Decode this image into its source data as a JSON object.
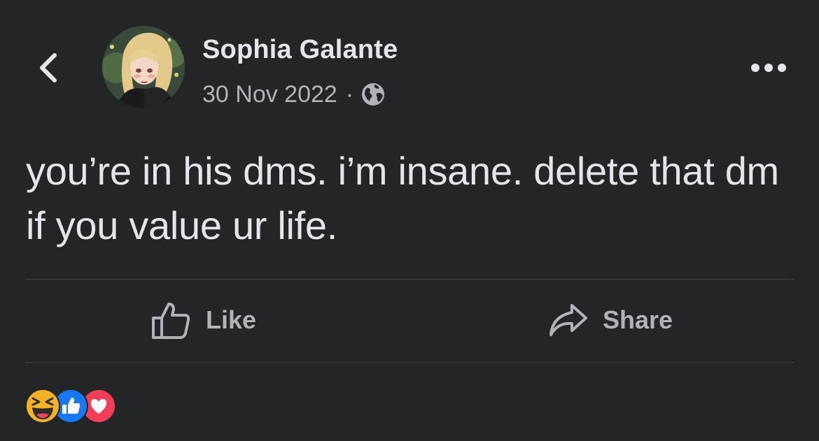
{
  "post": {
    "author": "Sophia Galante",
    "date": "30 Nov 2022",
    "separator": "·",
    "visibility_icon": "globe-icon",
    "text": "you’re in his dms. i’m insane. delete that dm if you value ur life."
  },
  "actions": {
    "like_label": "Like",
    "share_label": "Share"
  },
  "reactions": [
    "haha-reaction-icon",
    "like-reaction-icon",
    "love-reaction-icon"
  ],
  "colors": {
    "background": "#242526",
    "primary_text": "#e4e6eb",
    "secondary_text": "#b0b3b8",
    "divider": "#3e4042",
    "like_blue": "#1877f2",
    "love_red": "#f33e58",
    "haha_yellow": "#f7b125"
  }
}
